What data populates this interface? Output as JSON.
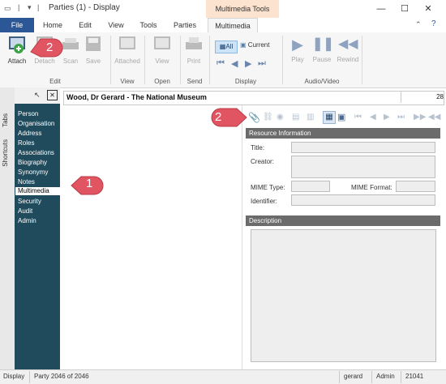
{
  "window": {
    "title": "Parties (1) - Display",
    "context_group": "Multimedia Tools",
    "minimize": "—",
    "maximize": "☐",
    "close": "✕"
  },
  "tabs": [
    "File",
    "Home",
    "Edit",
    "View",
    "Tools",
    "Parties",
    "Multimedia"
  ],
  "ribbon": {
    "buttons": {
      "attach": "Attach",
      "detach": "Detach",
      "scan": "Scan",
      "save": "Save",
      "attached": "Attached",
      "view": "View",
      "print": "Print",
      "all": "All",
      "current": "Current",
      "play": "Play",
      "pause": "Pause",
      "rewind": "Rewind"
    },
    "groups": {
      "edit": "Edit",
      "view": "View",
      "open": "Open",
      "send": "Send",
      "display": "Display",
      "audio_video": "Audio/Video"
    }
  },
  "side_tabs": {
    "tabs": "Tabs",
    "shortcuts": "Shortcuts"
  },
  "nav": {
    "items": [
      "Person",
      "Organisation",
      "Address",
      "Roles",
      "Associations",
      "Biography",
      "Synonymy",
      "Notes",
      "Multimedia",
      "Security",
      "Audit",
      "Admin"
    ],
    "selected": "Multimedia"
  },
  "record": {
    "title": "Wood, Dr Gerard - The National Museum",
    "number": "28"
  },
  "resource": {
    "section": "Resource Information",
    "title_label": "Title:",
    "creator_label": "Creator:",
    "mime_type_label": "MIME Type:",
    "mime_format_label": "MIME Format:",
    "identifier_label": "Identifier:",
    "description_section": "Description"
  },
  "callouts": {
    "one": "1",
    "two_ribbon": "2",
    "two_toolbar": "2"
  },
  "status": {
    "mode": "Display",
    "record": "Party 2046 of 2046",
    "user": "gerard",
    "role": "Admin",
    "count": "21041"
  },
  "colors": {
    "file_tab": "#2b5797",
    "context_tab": "#fbe3cf",
    "nav_panel": "#1f4b5c",
    "callout": "#e05561"
  }
}
